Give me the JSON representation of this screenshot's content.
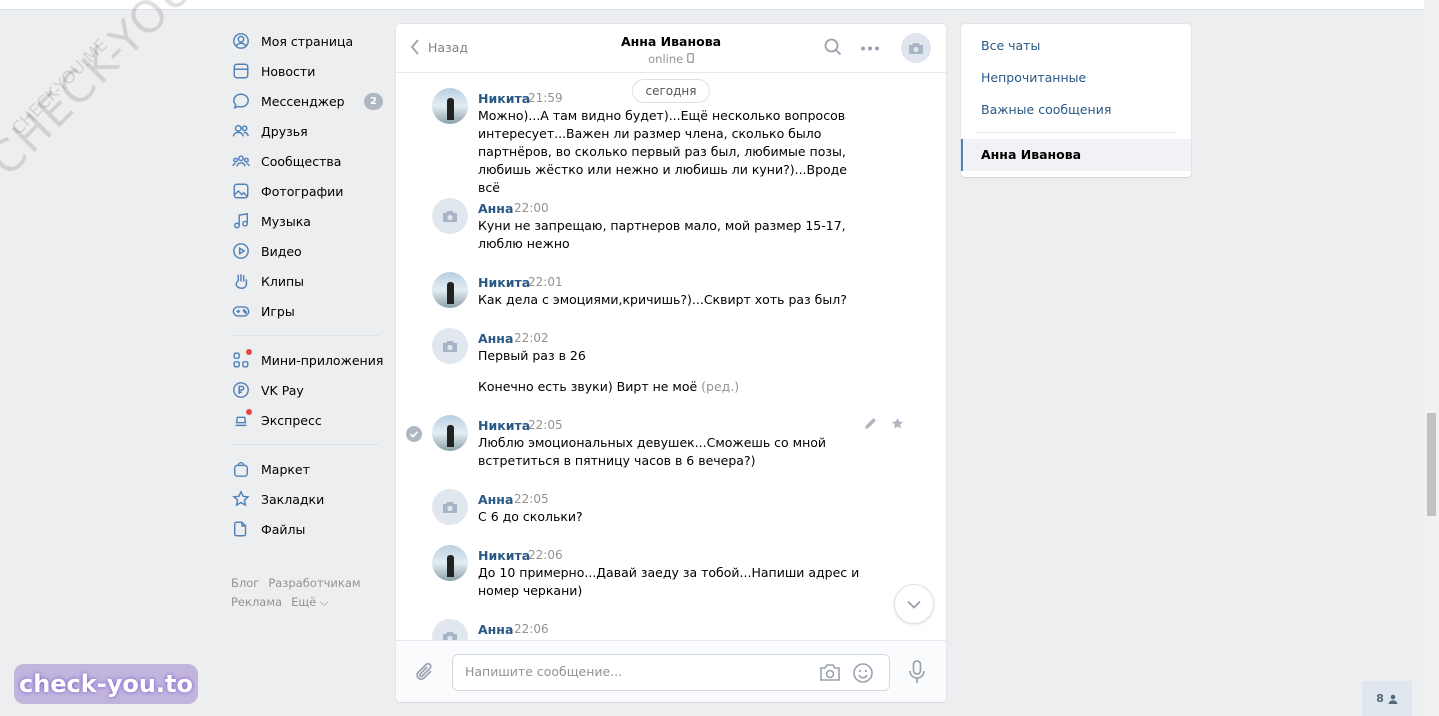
{
  "sidebar": {
    "items": [
      {
        "label": "Моя страница"
      },
      {
        "label": "Новости"
      },
      {
        "label": "Мессенджер",
        "badge": "2"
      },
      {
        "label": "Друзья"
      },
      {
        "label": "Сообщества"
      },
      {
        "label": "Фотографии"
      },
      {
        "label": "Музыка"
      },
      {
        "label": "Видео"
      },
      {
        "label": "Клипы"
      },
      {
        "label": "Игры"
      }
    ],
    "extra": [
      {
        "label": "Мини-приложения"
      },
      {
        "label": "VK Pay"
      },
      {
        "label": "Экспресс"
      }
    ],
    "more": [
      {
        "label": "Маркет"
      },
      {
        "label": "Закладки"
      },
      {
        "label": "Файлы"
      }
    ],
    "footer": [
      "Блог",
      "Разработчикам",
      "Реклама",
      "Ещё ⌵"
    ]
  },
  "chat": {
    "back_label": "Назад",
    "peer_name": "Анна Иванова",
    "peer_status": "online",
    "day_label": "сегодня",
    "messages": [
      {
        "author": "Никита",
        "time": "21:59",
        "text": "Можно)...А там видно будет)...Ещё несколько вопросов интересует...Важен ли размер члена, сколько было партнёров, во сколько первый раз был, любимые позы, любишь жёстко или нежно и любишь ли куни?)...Вроде всё"
      },
      {
        "author": "Анна",
        "time": "22:00",
        "text": "Куни не запрещаю, партнеров мало, мой размер 15-17, люблю нежно"
      },
      {
        "author": "Никита",
        "time": "22:01",
        "text": "Как дела с эмоциями,кричишь?)...Сквирт хоть раз был?"
      },
      {
        "author": "Анна",
        "time": "22:02",
        "text": "Первый раз в 26",
        "text2": "Конечно есть звуки) Вирт не моё",
        "edited": "(ред.)"
      },
      {
        "author": "Никита",
        "time": "22:05",
        "text": "Люблю эмоциональных девушек...Сможешь со мной встретиться в пятницу часов в 6 вечера?)"
      },
      {
        "author": "Анна",
        "time": "22:05",
        "text": "С 6 до скольки?"
      },
      {
        "author": "Никита",
        "time": "22:06",
        "text": "До 10 примерно...Давай заеду за тобой...Напиши адрес и номер черкани)"
      },
      {
        "author": "Анна",
        "time": "22:06",
        "text": ""
      }
    ],
    "composer_placeholder": "Напишите сообщение..."
  },
  "right_panel": {
    "items": [
      "Все чаты",
      "Непрочитанные",
      "Важные сообщения"
    ],
    "active_chat": "Анна Иванова"
  },
  "online_count": "8",
  "watermarks": {
    "large": "CHECK-YOU.ME",
    "small": "CHECK-YOU.ME",
    "badge": "check-you.to"
  },
  "colors": {
    "accent": "#5181b8",
    "link": "#2a5885",
    "background": "#edeef0"
  }
}
